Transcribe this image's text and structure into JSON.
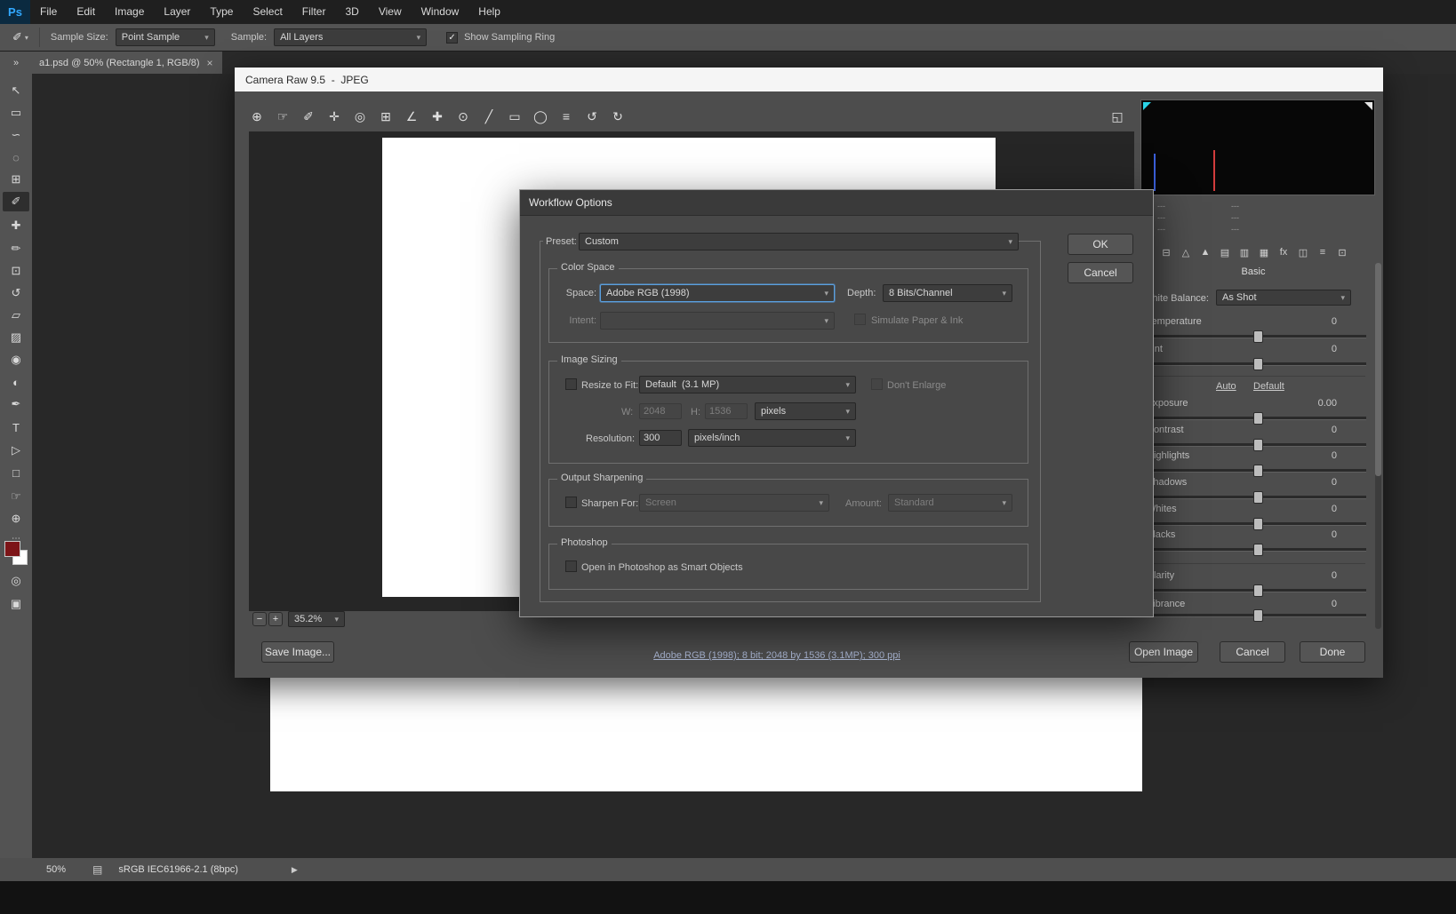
{
  "ui": {
    "caret": "▾",
    "check": "✓"
  },
  "colors": {
    "accent_blue": "#31a8ff",
    "focus_border": "#5aa0e0",
    "link": "#aab6d3",
    "foreground_swatch": "#7c1417",
    "clipping_cyan": "#2ad4e8",
    "histogram_red": "#d23c3c",
    "histogram_blue": "#3a5fd9"
  },
  "menubar": {
    "logo": "Ps",
    "items": [
      "File",
      "Edit",
      "Image",
      "Layer",
      "Type",
      "Select",
      "Filter",
      "3D",
      "View",
      "Window",
      "Help"
    ]
  },
  "options_bar": {
    "tool_glyph": "✐",
    "sample_size_label": "Sample Size:",
    "sample_size_value": "Point Sample",
    "sample_label": "Sample:",
    "sample_value": "All Layers",
    "sampling_ring_label": "Show Sampling Ring"
  },
  "tab": {
    "overflow": "»",
    "title": "a1.psd @ 50% (Rectangle 1, RGB/8)",
    "close": "×"
  },
  "tools": {
    "glyphs": [
      "↖",
      "▭",
      "∽",
      "◌",
      "⊞",
      "✐",
      "✚",
      "✏",
      "⊡",
      "↺",
      "▱",
      "▨",
      "◉",
      "◐",
      "✒",
      "T",
      "▷",
      "□",
      "☞",
      "⊕"
    ],
    "misc": "⋯",
    "mask": "◎",
    "screen_mode": "▣"
  },
  "camera_raw": {
    "title": "Camera Raw 9.5  -  JPEG",
    "toolbar_glyphs": [
      "⊕",
      "☞",
      "✐",
      "✛",
      "◎",
      "⊞",
      "∠",
      "✚",
      "⊙",
      "╱",
      "▭",
      "◯",
      "≡",
      "↺",
      "↻"
    ],
    "fullscreen_glyph": "◱",
    "zoom_out": "−",
    "zoom_in": "+",
    "zoom_value": "35.2%",
    "save_image": "Save Image...",
    "workflow_link": "Adobe RGB (1998); 8 bit; 2048 by 1536 (3.1MP); 300 ppi",
    "open_image": "Open Image",
    "cancel": "Cancel",
    "done": "Done",
    "panel": {
      "exif_left": [
        "---",
        "---",
        "---"
      ],
      "exif_right": [
        "---",
        "---",
        "---"
      ],
      "tab_glyphs": [
        "⊟",
        "△",
        "▲",
        "▤",
        "▥",
        "▦",
        "fx",
        "◫",
        "≡",
        "⊡"
      ],
      "section_title": "Basic",
      "wb_label": "White Balance:",
      "wb_value": "As Shot",
      "controls": [
        {
          "label": "Temperature",
          "value": "0"
        },
        {
          "label": "Tint",
          "value": "0"
        }
      ],
      "auto": "Auto",
      "default": "Default",
      "sliders": [
        {
          "label": "Exposure",
          "value": "0.00"
        },
        {
          "label": "Contrast",
          "value": "0"
        },
        {
          "label": "Highlights",
          "value": "0"
        },
        {
          "label": "Shadows",
          "value": "0"
        },
        {
          "label": "Whites",
          "value": "0"
        },
        {
          "label": "Blacks",
          "value": "0"
        },
        {
          "label": "Clarity",
          "value": "0"
        },
        {
          "label": "Vibrance",
          "value": "0"
        }
      ]
    }
  },
  "workflow_dialog": {
    "title": "Workflow Options",
    "preset_label": "Preset:",
    "preset_value": "Custom",
    "ok": "OK",
    "cancel": "Cancel",
    "color_space": {
      "group_label": "Color Space",
      "space_label": "Space:",
      "space_value": "Adobe RGB (1998)",
      "depth_label": "Depth:",
      "depth_value": "8 Bits/Channel",
      "intent_label": "Intent:",
      "intent_value": "",
      "simulate_label": "Simulate Paper & Ink"
    },
    "image_sizing": {
      "group_label": "Image Sizing",
      "resize_label": "Resize to Fit:",
      "resize_value": "Default  (3.1 MP)",
      "dont_enlarge_label": "Don't Enlarge",
      "w_label": "W:",
      "w_value": "2048",
      "h_label": "H:",
      "h_value": "1536",
      "unit_value": "pixels",
      "resolution_label": "Resolution:",
      "resolution_value": "300",
      "resolution_unit": "pixels/inch"
    },
    "output_sharpening": {
      "group_label": "Output Sharpening",
      "sharpen_label": "Sharpen For:",
      "sharpen_value": "Screen",
      "amount_label": "Amount:",
      "amount_value": "Standard"
    },
    "photoshop": {
      "group_label": "Photoshop",
      "smart_objects_label": "Open in Photoshop as Smart Objects"
    }
  },
  "status_bar": {
    "zoom": "50%",
    "icon_glyph": "▤",
    "profile": "sRGB IEC61966-2.1 (8bpc)",
    "arrow": "▶"
  }
}
